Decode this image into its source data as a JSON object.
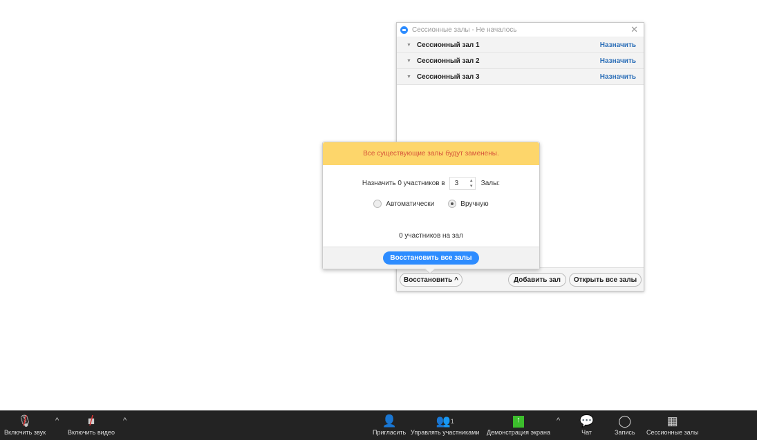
{
  "window": {
    "title": "Сессионные залы - Не началось",
    "rooms": [
      {
        "name": "Сессионный зал 1",
        "action": "Назначить"
      },
      {
        "name": "Сессионный зал 2",
        "action": "Назначить"
      },
      {
        "name": "Сессионный зал 3",
        "action": "Назначить"
      }
    ],
    "footer": {
      "restore": "Восстановить",
      "add_room": "Добавить зал",
      "open_all": "Открыть все залы"
    }
  },
  "popup": {
    "warning": "Все существующие залы будут заменены.",
    "assign_prefix": "Назначить 0 участников в",
    "room_count": "3",
    "rooms_label": "Залы:",
    "auto": "Автоматически",
    "manual": "Вручную",
    "per_room": "0 участников на зал",
    "restore_all": "Восстановить все залы"
  },
  "toolbar": {
    "audio": "Включить звук",
    "video": "Включить видео",
    "invite": "Пригласить",
    "participants": "Управлять участниками",
    "participants_count": "1",
    "share": "Демонстрация экрана",
    "chat": "Чат",
    "record": "Запись",
    "breakout": "Сессионные залы"
  }
}
